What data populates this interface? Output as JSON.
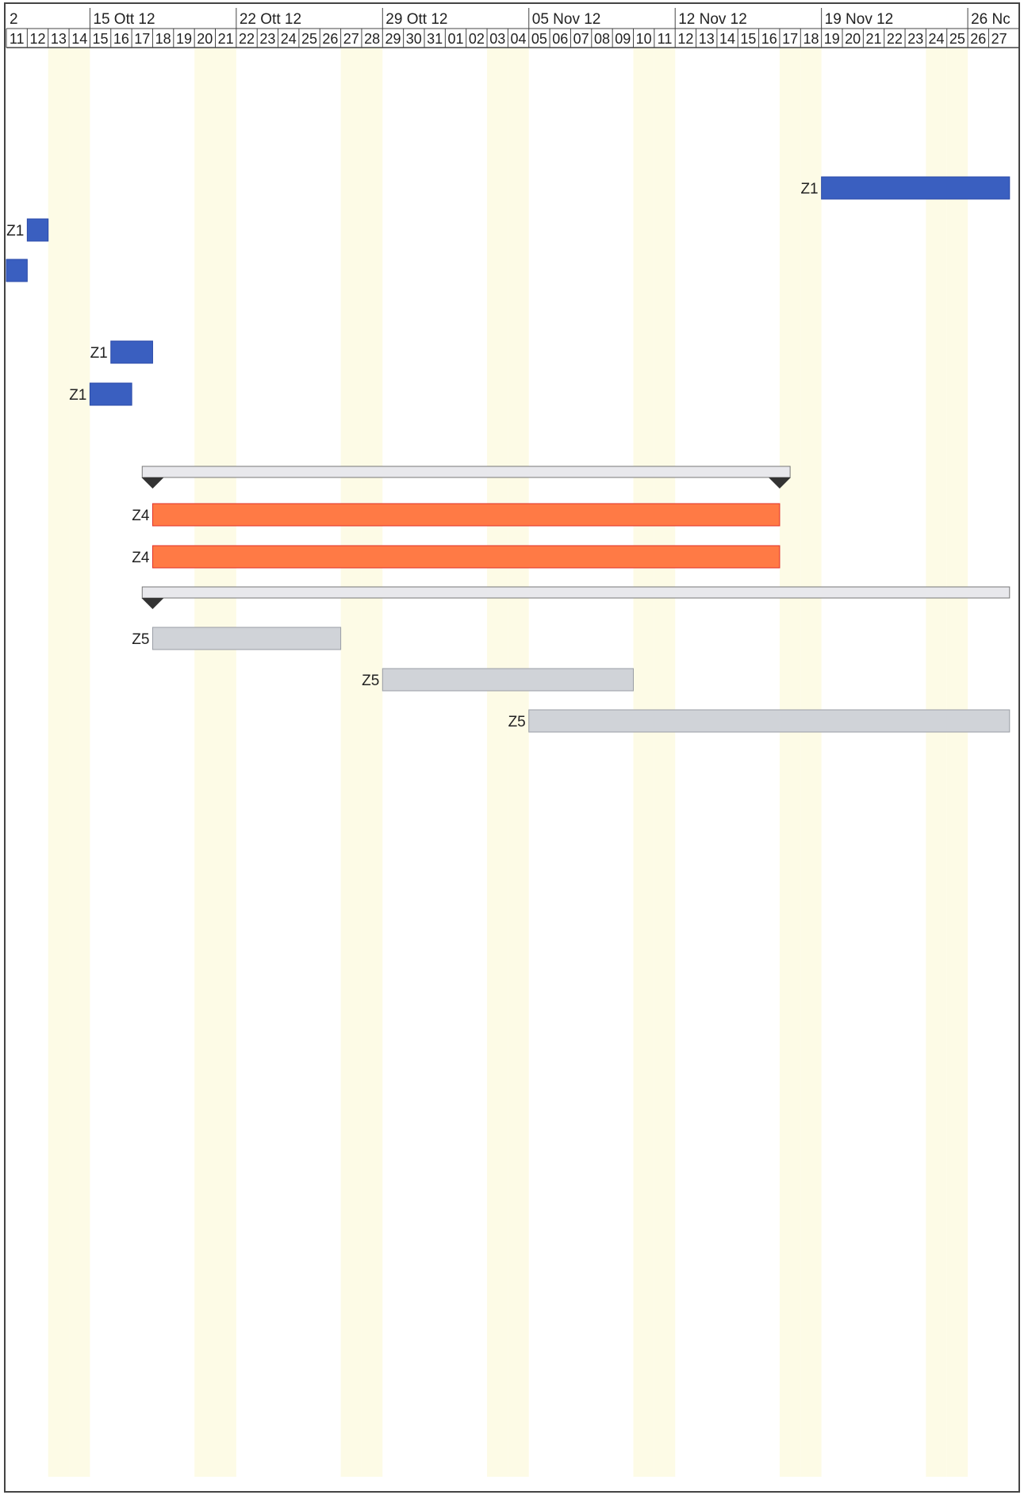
{
  "chart_data": {
    "type": "gantt",
    "first_day": "11",
    "week_headers": [
      {
        "label": "2",
        "start_day_index": 0
      },
      {
        "label": "15 Ott 12",
        "start_day_index": 4
      },
      {
        "label": "22 Ott 12",
        "start_day_index": 11
      },
      {
        "label": "29 Ott 12",
        "start_day_index": 18
      },
      {
        "label": "05 Nov 12",
        "start_day_index": 25
      },
      {
        "label": "12 Nov 12",
        "start_day_index": 32
      },
      {
        "label": "19 Nov 12",
        "start_day_index": 39
      },
      {
        "label": "26 Nc",
        "start_day_index": 46
      }
    ],
    "day_labels": [
      "11",
      "12",
      "13",
      "14",
      "15",
      "16",
      "17",
      "18",
      "19",
      "20",
      "21",
      "22",
      "23",
      "24",
      "25",
      "26",
      "27",
      "28",
      "29",
      "30",
      "31",
      "01",
      "02",
      "03",
      "04",
      "05",
      "06",
      "07",
      "08",
      "09",
      "10",
      "11",
      "12",
      "13",
      "14",
      "15",
      "16",
      "17",
      "18",
      "19",
      "20",
      "21",
      "22",
      "23",
      "24",
      "25",
      "26",
      "27"
    ],
    "weekend_day_indices": [
      2,
      3,
      9,
      10,
      16,
      17,
      23,
      24,
      30,
      31,
      37,
      38,
      44,
      45
    ],
    "colors": {
      "z1": "#3a5fc0",
      "z4": "#ff7a45",
      "z4_edge": "#e0302a",
      "z5": "#d0d3d8",
      "summary": "#e8e8ec",
      "milestone": "#333333",
      "weekend": "#fdfbe6",
      "grid": "#444444"
    },
    "tasks": [
      {
        "label": "Z1",
        "kind": "z1",
        "row": 0,
        "start": 39,
        "end": 48
      },
      {
        "label": "Z1",
        "kind": "z1",
        "row": 1,
        "start": 1,
        "end": 2
      },
      {
        "label": "",
        "kind": "z1",
        "row": 2,
        "start": 0,
        "end": 1
      },
      {
        "label": "Z1",
        "kind": "z1",
        "row": 3,
        "start": 5,
        "end": 7
      },
      {
        "label": "Z1",
        "kind": "z1",
        "row": 4,
        "start": 4,
        "end": 6
      },
      {
        "label": "",
        "kind": "summary",
        "row": 5,
        "start": 6.5,
        "end": 37.5,
        "markers": [
          7,
          37
        ]
      },
      {
        "label": "Z4",
        "kind": "z4",
        "row": 6,
        "start": 7,
        "end": 37
      },
      {
        "label": "Z4",
        "kind": "z4",
        "row": 7,
        "start": 7,
        "end": 37
      },
      {
        "label": "",
        "kind": "summary",
        "row": 8,
        "start": 6.5,
        "end": 48,
        "markers": [
          7
        ]
      },
      {
        "label": "Z5",
        "kind": "z5",
        "row": 9,
        "start": 7,
        "end": 16
      },
      {
        "label": "Z5",
        "kind": "z5",
        "row": 10,
        "start": 18,
        "end": 30
      },
      {
        "label": "Z5",
        "kind": "z5",
        "row": 11,
        "start": 25,
        "end": 48
      }
    ]
  }
}
